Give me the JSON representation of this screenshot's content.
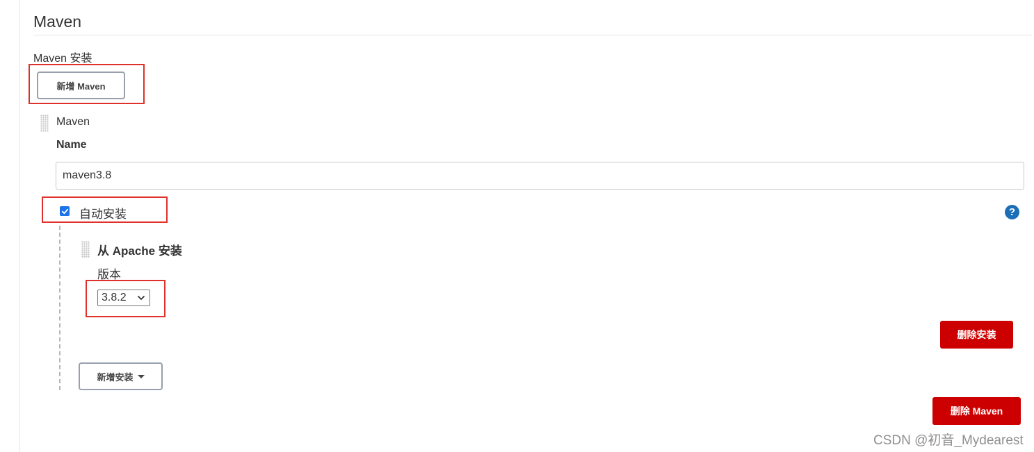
{
  "section": {
    "title": "Maven",
    "installs_label": "Maven 安装",
    "add_maven_button": "新增 Maven"
  },
  "maven_item": {
    "title": "Maven",
    "name_label": "Name",
    "name_value": "maven3.8",
    "auto_install_label": "自动安装",
    "auto_install_checked": true,
    "help_symbol": "?",
    "installer": {
      "title": "从 Apache 安装",
      "version_label": "版本",
      "version_selected": "3.8.2",
      "delete_installer_button": "删除安装"
    },
    "add_installer_button": "新增安装",
    "delete_maven_button": "删除 Maven"
  },
  "watermark": "CSDN @初音_Mydearest",
  "colors": {
    "danger": "#cc0000",
    "highlight": "#e0302b",
    "checkbox": "#1a73e8",
    "help": "#1c6fb7"
  },
  "icons": {
    "drag_handle": "drag-handle-icon",
    "help": "help-icon",
    "caret": "caret-down-icon",
    "chevron": "chevron-down-icon",
    "check": "check-icon"
  }
}
